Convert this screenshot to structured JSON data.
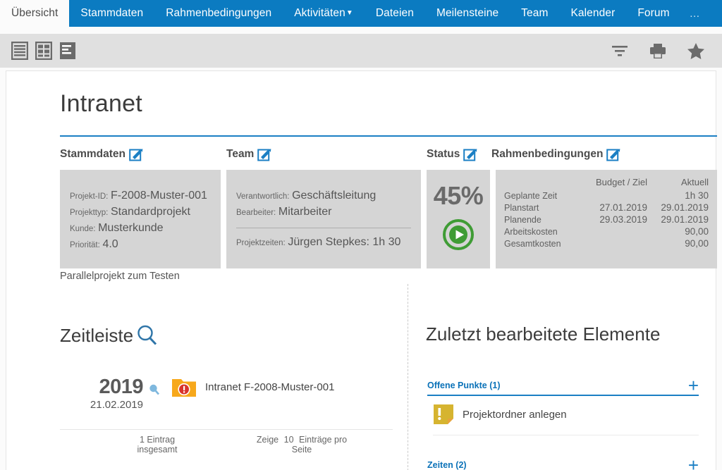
{
  "tabs": [
    {
      "label": "Übersicht",
      "active": true,
      "caret": false
    },
    {
      "label": "Stammdaten",
      "active": false,
      "caret": false
    },
    {
      "label": "Rahmenbedingungen",
      "active": false,
      "caret": false
    },
    {
      "label": "Aktivitäten",
      "active": false,
      "caret": true
    },
    {
      "label": "Dateien",
      "active": false,
      "caret": false
    },
    {
      "label": "Meilensteine",
      "active": false,
      "caret": false
    },
    {
      "label": "Team",
      "active": false,
      "caret": false
    },
    {
      "label": "Kalender",
      "active": false,
      "caret": false
    },
    {
      "label": "Forum",
      "active": false,
      "caret": false
    }
  ],
  "tabs_overflow": "…",
  "toolbar": {
    "left_icons": [
      "list-view-icon",
      "table-view-icon",
      "detail-view-icon"
    ],
    "right_icons": [
      "filter-icon",
      "print-icon",
      "favorite-star-icon"
    ]
  },
  "page": {
    "title": "Intranet",
    "subtitle": "Parallelprojekt zum Testen"
  },
  "panels": {
    "stammdaten": {
      "header": "Stammdaten",
      "rows": [
        {
          "key": "Projekt-ID:",
          "value": "F-2008-Muster-001"
        },
        {
          "key": "Projekttyp:",
          "value": "Standardprojekt"
        },
        {
          "key": "Kunde:",
          "value": "Musterkunde"
        },
        {
          "key": "Priorität:",
          "value": "4.0"
        }
      ]
    },
    "team": {
      "header": "Team",
      "rows": [
        {
          "key": "Verantwortlich:",
          "value": "Geschäftsleitung"
        },
        {
          "key": "Bearbeiter:",
          "value": "Mitarbeiter"
        }
      ],
      "times_key": "Projektzeiten:",
      "times_value": "Jürgen Stepkes: 1h 30"
    },
    "status": {
      "header": "Status",
      "percent": "45%",
      "action_icon": "play-button-icon"
    },
    "rahmenbedingungen": {
      "header": "Rahmenbedingungen",
      "columns": [
        "",
        "Budget / Ziel",
        "Aktuell"
      ],
      "rows": [
        {
          "label": "Geplante Zeit",
          "budget": "",
          "aktuell": "1h 30"
        },
        {
          "label": "Planstart",
          "budget": "27.01.2019",
          "aktuell": "29.01.2019"
        },
        {
          "label": "Planende",
          "budget": "29.03.2019",
          "aktuell": "29.01.2019"
        },
        {
          "label": "Arbeitskosten",
          "budget": "",
          "aktuell": "90,00"
        },
        {
          "label": "Gesamtkosten",
          "budget": "",
          "aktuell": "90,00"
        }
      ]
    }
  },
  "zeitleiste": {
    "title": "Zeitleiste",
    "search_icon": "search-magnifier-icon",
    "entry": {
      "year": "2019",
      "date": "21.02.2019",
      "zoom_icon": "magnifier-small-icon",
      "item_icon": "folder-alert-icon",
      "label": "Intranet F-2008-Muster-001"
    },
    "footer": {
      "total_line1": "1 Eintrag",
      "total_line2": "insgesamt",
      "per_page_line1_a": "Zeige",
      "per_page_count": "10",
      "per_page_line1_b": "Einträge pro",
      "per_page_line2": "Seite"
    }
  },
  "recent": {
    "title": "Zuletzt bearbeitete Elemente",
    "sections": [
      {
        "label": "Offene Punkte (1)",
        "add_label": "+",
        "items": [
          {
            "icon": "note-alert-icon",
            "label": "Projektordner anlegen"
          }
        ]
      },
      {
        "label": "Zeiten (2)",
        "add_label": "+",
        "items": []
      }
    ]
  },
  "colors": {
    "accent": "#0b7bc1",
    "rule": "#1b7fc4",
    "panel_bg": "#d5d5d5",
    "toolbar_bg": "#e0e0e0",
    "green": "#3f9c35",
    "orange": "#f7a81b",
    "red": "#d9342b",
    "gold": "#d6b430"
  }
}
